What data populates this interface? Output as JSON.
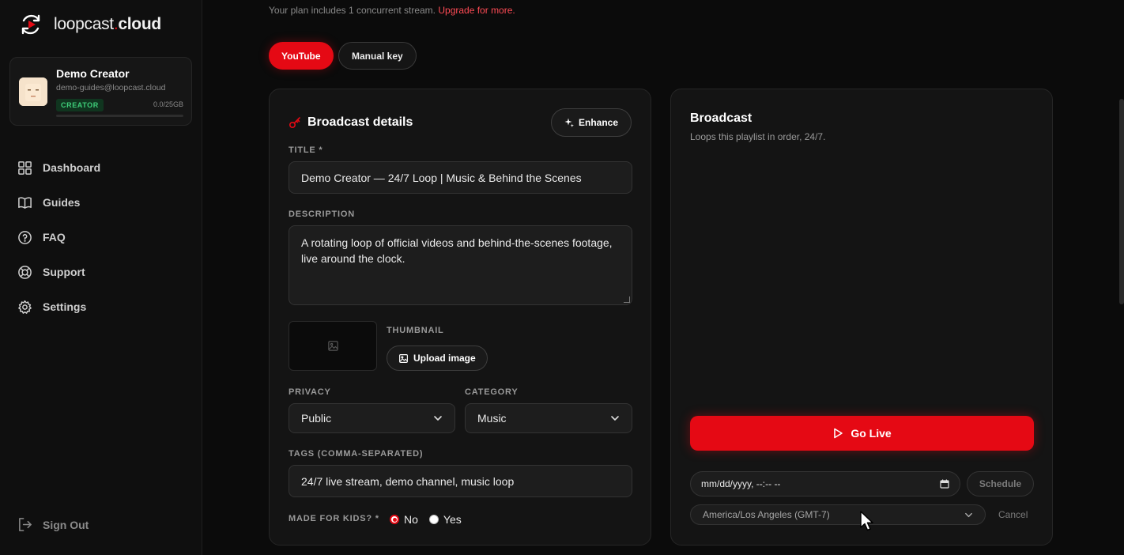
{
  "app": {
    "brand_main": "loopcast",
    "brand_dot": ".",
    "brand_bold": "cloud"
  },
  "profile": {
    "name": "Demo Creator",
    "email": "demo-guides@loopcast.cloud",
    "badge": "CREATOR",
    "storage": "0.0/25GB",
    "storage_fraction": 0.0
  },
  "sidebar": {
    "items": [
      {
        "label": "Dashboard",
        "icon": "grid-icon"
      },
      {
        "label": "Guides",
        "icon": "book-icon"
      },
      {
        "label": "FAQ",
        "icon": "help-circle-icon"
      },
      {
        "label": "Support",
        "icon": "lifebuoy-icon"
      },
      {
        "label": "Settings",
        "icon": "gear-icon"
      }
    ],
    "signout": "Sign Out"
  },
  "plan": {
    "note": "Your plan includes 1 concurrent stream.",
    "link": "Upgrade for more."
  },
  "tabs": {
    "youtube": "YouTube",
    "manual": "Manual key"
  },
  "details": {
    "title": "Broadcast details",
    "enhance": "Enhance",
    "title_label": "TITLE *",
    "title_value": "Demo Creator — 24/7 Loop | Music & Behind the Scenes",
    "desc_label": "DESCRIPTION",
    "desc_value": "A rotating loop of official videos and behind-the-scenes footage, live around the clock.",
    "thumb_label": "THUMBNAIL",
    "upload": "Upload image",
    "privacy_label": "PRIVACY",
    "privacy_value": "Public",
    "category_label": "CATEGORY",
    "category_value": "Music",
    "tags_label": "TAGS (COMMA-SEPARATED)",
    "tags_value": "24/7 live stream, demo channel, music loop",
    "kids_label": "MADE FOR KIDS? *",
    "kids_no": "No",
    "kids_yes": "Yes"
  },
  "broadcast": {
    "title": "Broadcast",
    "subtitle": "Loops this playlist in order, 24/7.",
    "golive": "Go Live",
    "datetime_placeholder": "mm/dd/yyyy, --:-- --",
    "schedule": "Schedule",
    "timezone": "America/Los Angeles (GMT-7)",
    "cancel": "Cancel"
  },
  "colors": {
    "accent": "#e50914",
    "badge_green": "#3fcf7a"
  }
}
